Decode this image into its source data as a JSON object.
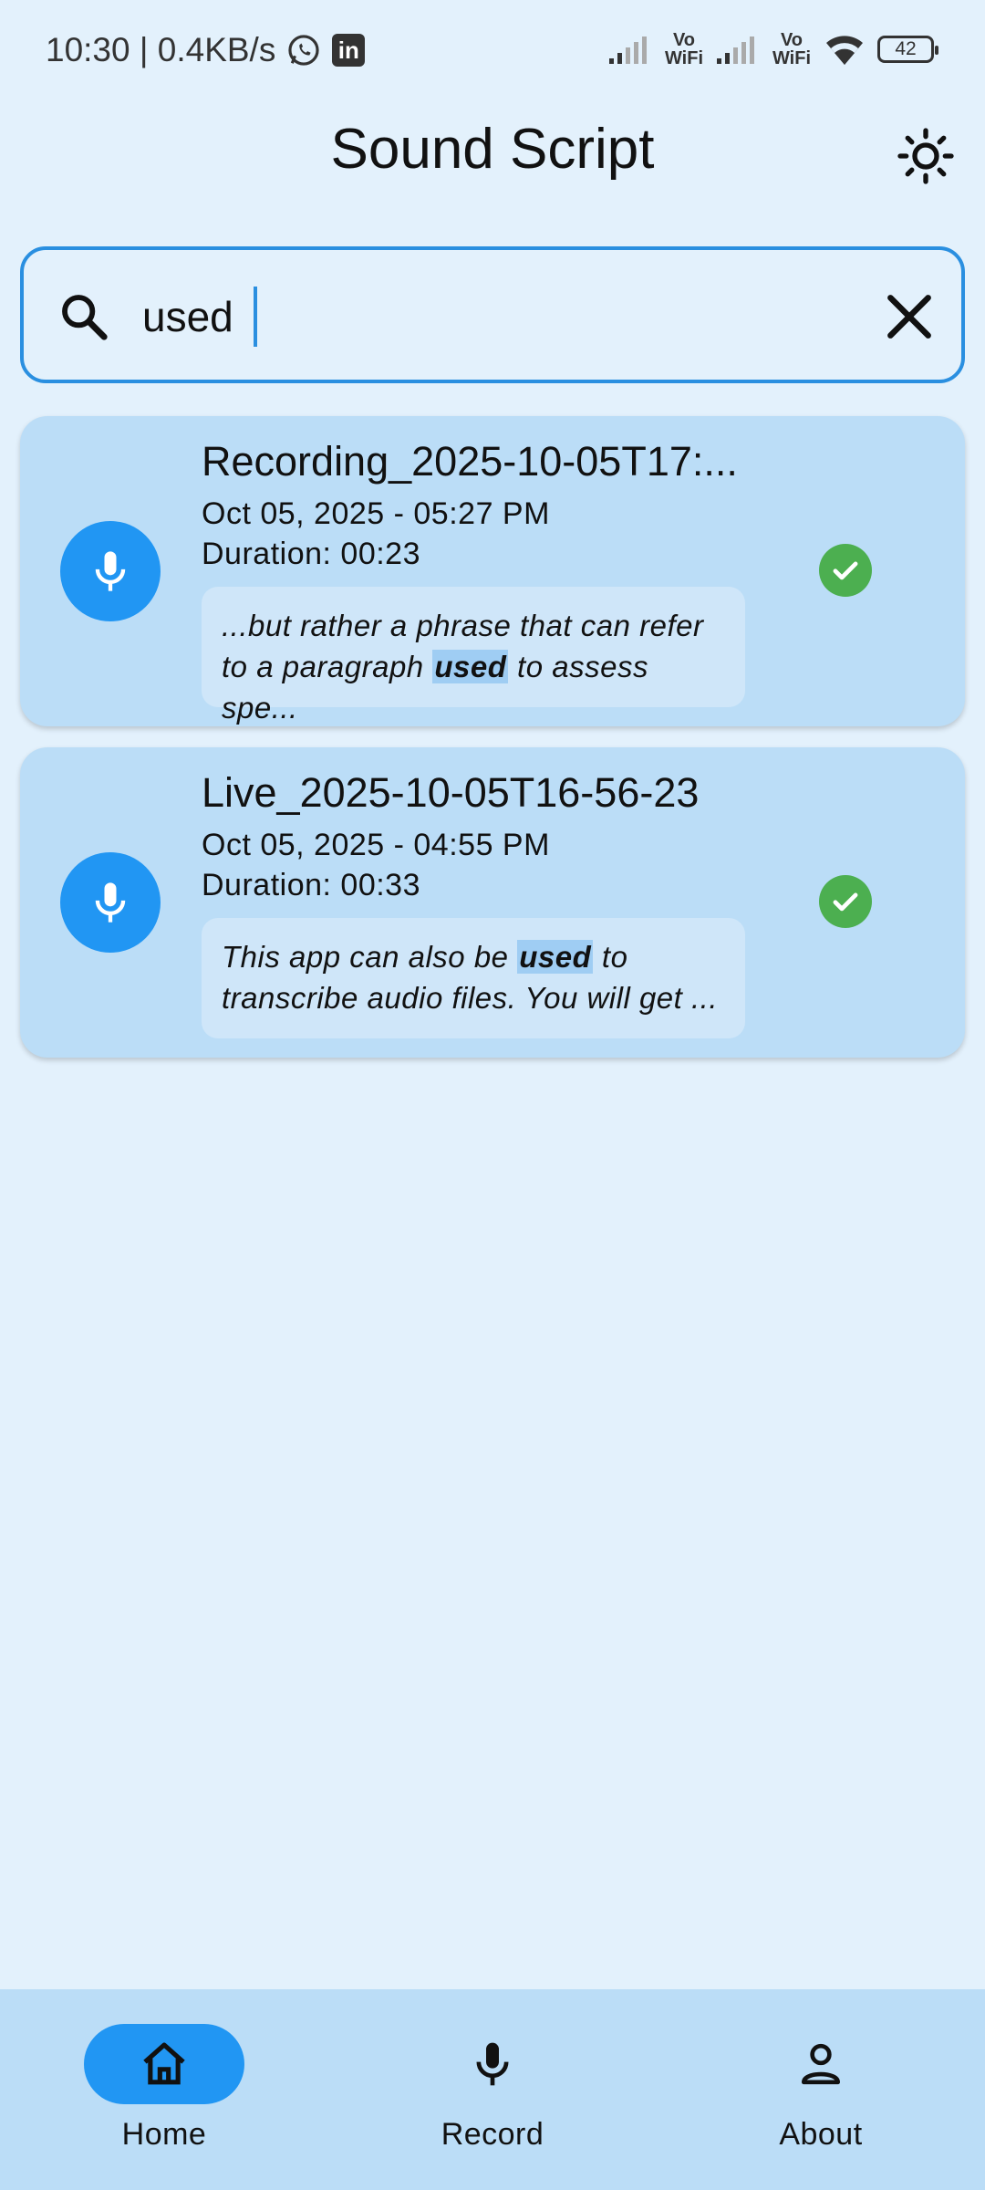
{
  "status_bar": {
    "time_speed": "10:30 | 0.4KB/s",
    "vowifi_1": "Vo WiFi",
    "vowifi_2": "Vo WiFi",
    "battery": "42"
  },
  "app_bar": {
    "title": "Sound Script",
    "theme_icon": "sun-icon"
  },
  "search": {
    "value": "used",
    "placeholder": "",
    "icon": "search-icon",
    "clear_icon": "close-icon"
  },
  "recordings": [
    {
      "title": "Recording_2025-10-05T17:...",
      "date": "Oct 05, 2025 - 05:27 PM",
      "duration": "Duration: 00:23",
      "snippet_before": "...but rather a phrase that can refer to a paragraph ",
      "snippet_match": "used",
      "snippet_after": " to assess spe...",
      "status": "check-icon"
    },
    {
      "title": "Live_2025-10-05T16-56-23",
      "date": "Oct 05, 2025 - 04:55 PM",
      "duration": "Duration: 00:33",
      "snippet_before": "This app can also be ",
      "snippet_match": "used",
      "snippet_after": " to transcribe audio files. You will get ...",
      "status": "check-icon"
    }
  ],
  "bottom_nav": {
    "home": "Home",
    "record": "Record",
    "about": "About"
  },
  "colors": {
    "accent": "#2196f3",
    "card": "#bbddf7",
    "background": "#e3f1fc",
    "success": "#4caf50"
  }
}
